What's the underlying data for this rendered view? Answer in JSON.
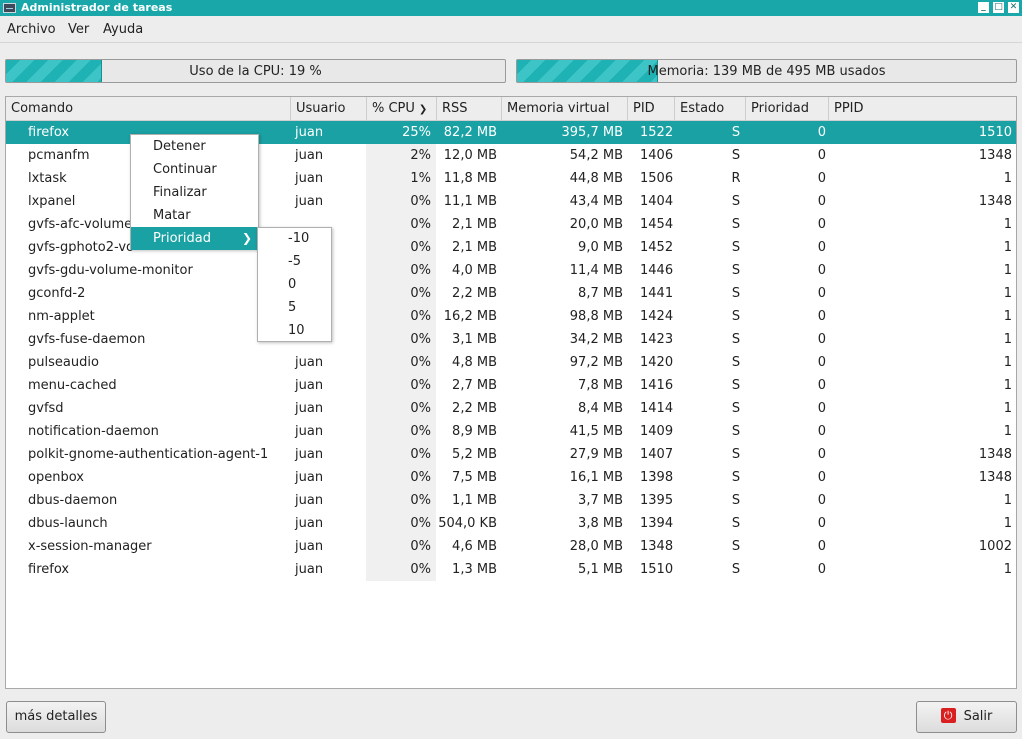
{
  "window": {
    "title": "Administrador de tareas",
    "controls": [
      "minimize-icon",
      "maximize-icon",
      "close-icon"
    ]
  },
  "menubar": {
    "items": [
      "Archivo",
      "Ver",
      "Ayuda"
    ]
  },
  "meters": {
    "cpu": {
      "label": "Uso de la CPU: 19 %",
      "value": 0.19
    },
    "memory": {
      "label": "Memoria: 139 MB de 495 MB usados",
      "value": 0.281
    }
  },
  "table": {
    "columns": [
      "Comando",
      "Usuario",
      "% CPU",
      "RSS",
      "Memoria virtual",
      "PID",
      "Estado",
      "Prioridad",
      "PPID"
    ],
    "sort_column": "% CPU",
    "selected_row": 0,
    "rows": [
      [
        "firefox",
        "juan",
        "25%",
        "82,2 MB",
        "395,7 MB",
        "1522",
        "S",
        "0",
        "1510"
      ],
      [
        "pcmanfm",
        "juan",
        "2%",
        "12,0 MB",
        "54,2 MB",
        "1406",
        "S",
        "0",
        "1348"
      ],
      [
        "lxtask",
        "juan",
        "1%",
        "11,8 MB",
        "44,8 MB",
        "1506",
        "R",
        "0",
        "1"
      ],
      [
        "lxpanel",
        "juan",
        "0%",
        "11,1 MB",
        "43,4 MB",
        "1404",
        "S",
        "0",
        "1348"
      ],
      [
        "gvfs-afc-volume",
        "",
        "0%",
        "2,1 MB",
        "20,0 MB",
        "1454",
        "S",
        "0",
        "1"
      ],
      [
        "gvfs-gphoto2-vo",
        "",
        "0%",
        "2,1 MB",
        "9,0 MB",
        "1452",
        "S",
        "0",
        "1"
      ],
      [
        "gvfs-gdu-volume-monitor",
        "",
        "0%",
        "4,0 MB",
        "11,4 MB",
        "1446",
        "S",
        "0",
        "1"
      ],
      [
        "gconfd-2",
        "",
        "0%",
        "2,2 MB",
        "8,7 MB",
        "1441",
        "S",
        "0",
        "1"
      ],
      [
        "nm-applet",
        "",
        "0%",
        "16,2 MB",
        "98,8 MB",
        "1424",
        "S",
        "0",
        "1"
      ],
      [
        "gvfs-fuse-daemon",
        "",
        "0%",
        "3,1 MB",
        "34,2 MB",
        "1423",
        "S",
        "0",
        "1"
      ],
      [
        "pulseaudio",
        "juan",
        "0%",
        "4,8 MB",
        "97,2 MB",
        "1420",
        "S",
        "0",
        "1"
      ],
      [
        "menu-cached",
        "juan",
        "0%",
        "2,7 MB",
        "7,8 MB",
        "1416",
        "S",
        "0",
        "1"
      ],
      [
        "gvfsd",
        "juan",
        "0%",
        "2,2 MB",
        "8,4 MB",
        "1414",
        "S",
        "0",
        "1"
      ],
      [
        "notification-daemon",
        "juan",
        "0%",
        "8,9 MB",
        "41,5 MB",
        "1409",
        "S",
        "0",
        "1"
      ],
      [
        "polkit-gnome-authentication-agent-1",
        "juan",
        "0%",
        "5,2 MB",
        "27,9 MB",
        "1407",
        "S",
        "0",
        "1348"
      ],
      [
        "openbox",
        "juan",
        "0%",
        "7,5 MB",
        "16,1 MB",
        "1398",
        "S",
        "0",
        "1348"
      ],
      [
        "dbus-daemon",
        "juan",
        "0%",
        "1,1 MB",
        "3,7 MB",
        "1395",
        "S",
        "0",
        "1"
      ],
      [
        "dbus-launch",
        "juan",
        "0%",
        "504,0 KB",
        "3,8 MB",
        "1394",
        "S",
        "0",
        "1"
      ],
      [
        "x-session-manager",
        "juan",
        "0%",
        "4,6 MB",
        "28,0 MB",
        "1348",
        "S",
        "0",
        "1002"
      ],
      [
        "firefox",
        "juan",
        "0%",
        "1,3 MB",
        "5,1 MB",
        "1510",
        "S",
        "0",
        "1"
      ]
    ]
  },
  "context_menu": {
    "items": [
      "Detener",
      "Continuar",
      "Finalizar",
      "Matar",
      "Prioridad"
    ],
    "active_item": "Prioridad",
    "submenu": [
      "-10",
      "-5",
      "0",
      "5",
      "10"
    ]
  },
  "buttons": {
    "details": "más detalles",
    "quit": "Salir"
  },
  "colors": {
    "accent": "#1aa7a9",
    "selection": "#1aa1a3",
    "quit_icon": "#d91f1f"
  }
}
